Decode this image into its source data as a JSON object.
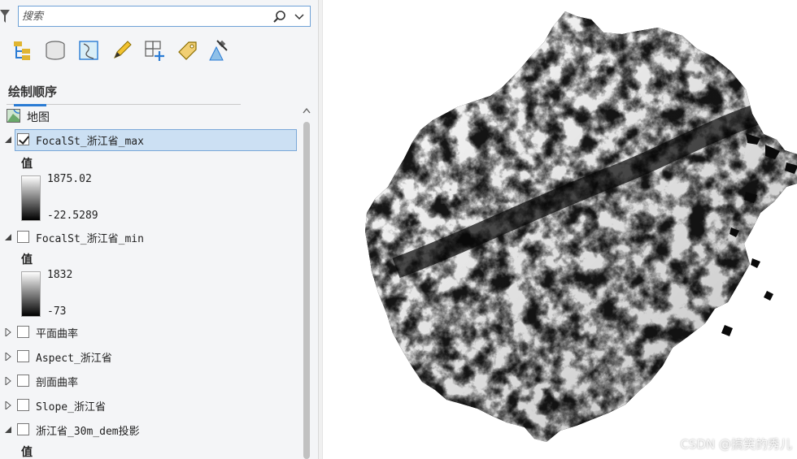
{
  "search": {
    "placeholder": "搜索"
  },
  "toolbar": {
    "tools": [
      "list-by-drawing-order-icon",
      "list-by-data-source-icon",
      "list-by-selection-icon",
      "list-by-editing-icon",
      "list-by-snapping-icon",
      "list-by-labeling-icon",
      "list-by-perspective-imagery-icon"
    ]
  },
  "section": {
    "title": "绘制顺序"
  },
  "map": {
    "label": "地图"
  },
  "layers": [
    {
      "name": "FocalSt_浙江省_max",
      "checked": true,
      "expanded": true,
      "selected": true,
      "legend_title": "值",
      "high": "1875.02",
      "low": "-22.5289"
    },
    {
      "name": "FocalSt_浙江省_min",
      "checked": false,
      "expanded": true,
      "selected": false,
      "legend_title": "值",
      "high": "1832",
      "low": "-73"
    },
    {
      "name": "平面曲率",
      "checked": false,
      "expanded": false
    },
    {
      "name": "Aspect_浙江省",
      "checked": false,
      "expanded": false
    },
    {
      "name": "剖面曲率",
      "checked": false,
      "expanded": false
    },
    {
      "name": "Slope_浙江省",
      "checked": false,
      "expanded": false
    },
    {
      "name": "浙江省_30m_dem投影",
      "checked": false,
      "expanded": true,
      "legend_title": "值"
    }
  ],
  "watermark": "CSDN @搞笑的秀儿",
  "colors": {
    "accent": "#2a7bd4",
    "selection": "#cce0f3",
    "raster_low": "#000000",
    "raster_high": "#ffffff"
  }
}
